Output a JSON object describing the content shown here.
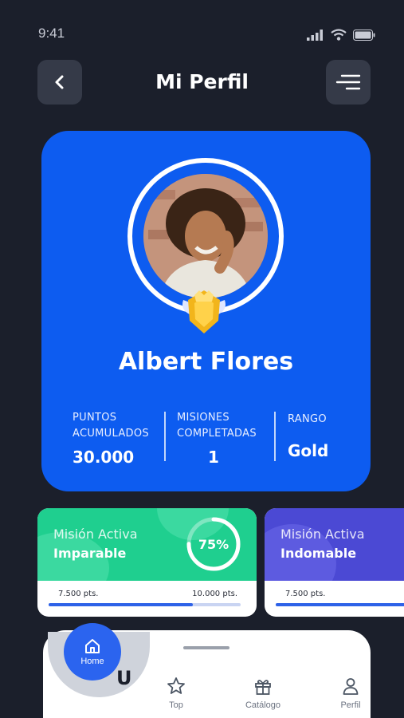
{
  "status": {
    "time": "9:41"
  },
  "header": {
    "title": "Mi Perfil"
  },
  "profile": {
    "name": "Albert Flores",
    "stats": [
      {
        "label_line1": "PUNTOS",
        "label_line2": "ACUMULADOS",
        "value": "30.000"
      },
      {
        "label_line1": "MISIONES",
        "label_line2": "COMPLETADAS",
        "value": "1"
      },
      {
        "label_line1": "RANGO",
        "label_line2": "",
        "value": "Gold"
      }
    ]
  },
  "missions": [
    {
      "subtitle": "Misión Activa",
      "title": "Imparable",
      "progress_label": "75%",
      "progress_fraction": 0.75,
      "points_current": "7.500 pts.",
      "points_target": "10.000 pts.",
      "color": "#1fcf8f"
    },
    {
      "subtitle": "Misión Activa",
      "title": "Indomable",
      "points_current": "7.500 pts.",
      "color": "#4b49d4"
    }
  ],
  "tabbar": {
    "home": "Home",
    "partial_letter": "U",
    "items": [
      {
        "label": "Top",
        "icon": "star-icon"
      },
      {
        "label": "Catálogo",
        "icon": "gift-icon"
      },
      {
        "label": "Perfil",
        "icon": "user-icon"
      }
    ]
  },
  "colors": {
    "background": "#1b1f2b",
    "card_blue": "#0d5cf0",
    "accent_green": "#1fcf8f",
    "accent_purple": "#4b49d4",
    "home_button": "#2b64ef"
  }
}
